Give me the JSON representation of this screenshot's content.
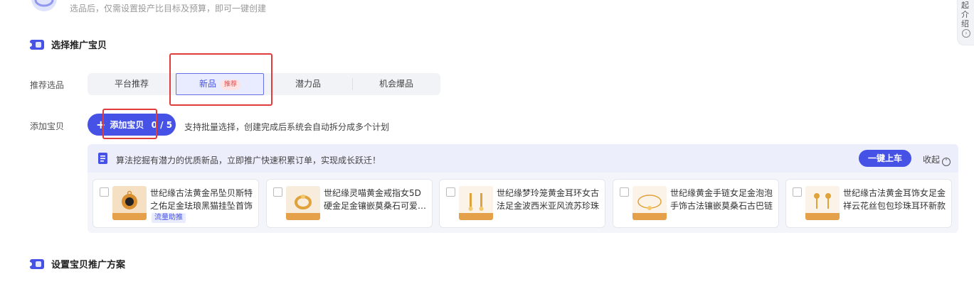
{
  "top_note": "选品后，仅需设置投产比目标及预算，即可一键创建",
  "right_tab": {
    "label": "起介绍"
  },
  "section1": {
    "title": "选择推广宝贝"
  },
  "recommend": {
    "label": "推荐选品",
    "options": [
      {
        "label": "平台推荐"
      },
      {
        "label": "新品",
        "tag": "推荐"
      },
      {
        "label": "潜力品"
      },
      {
        "label": "机会爆品"
      }
    ],
    "selected": "新品"
  },
  "add_item": {
    "label": "添加宝贝",
    "button_label": "添加宝贝",
    "count": "0 / 5",
    "hint": "支持批量选择，创建完成后系统会自动拆分成多个计划"
  },
  "panel": {
    "banner_text": "算法挖掘有潜力的优质新品，立即推广快速积累订单，实现成长跃迁！",
    "one_click_label": "一键上车",
    "collapse_label": "收起",
    "products": [
      {
        "line1": "世纪缘古法黄金吊坠贝斯特",
        "line2": "之佑足金珐琅黑猫挂坠首饰",
        "badge": "流量助推"
      },
      {
        "line1": "世纪缘灵喵黄金戒指女5D",
        "line2": "硬金足金镶嵌莫桑石可爱猫咪",
        "badge": ""
      },
      {
        "line1": "世纪缘梦玲笼黄金耳环女古",
        "line2": "法足金波西米亚风流苏珍珠",
        "badge": ""
      },
      {
        "line1": "世纪缘黄金手链女足金泡泡",
        "line2": "手饰古法镶嵌莫桑石古巴链",
        "badge": ""
      },
      {
        "line1": "世纪缘古法黄金耳饰女足金",
        "line2": "祥云花丝包包珍珠耳环新款",
        "badge": ""
      }
    ]
  },
  "section2": {
    "title": "设置宝贝推广方案"
  },
  "colors": {
    "accent": "#4652e6",
    "highlight_box": "#e03c3c",
    "panel_bg": "#f4f5fa"
  }
}
